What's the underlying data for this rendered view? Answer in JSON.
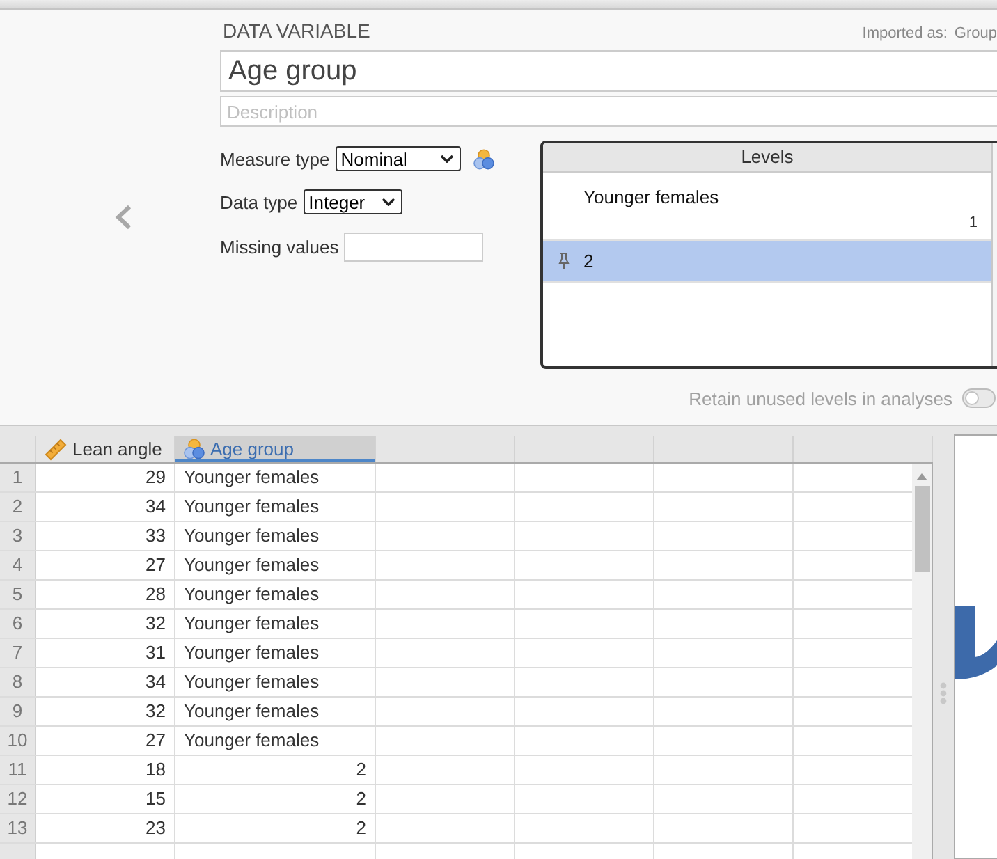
{
  "variable_editor": {
    "heading": "DATA VARIABLE",
    "imported_as": {
      "label": "Imported as:",
      "value": "Group"
    },
    "name": "Age group",
    "description": {
      "placeholder": "Description"
    },
    "measure_type": {
      "label": "Measure type",
      "value": "Nominal",
      "kind": "nominal"
    },
    "data_type": {
      "label": "Data type",
      "value": "Integer"
    },
    "missing_values": {
      "label": "Missing values"
    },
    "levels": {
      "title": "Levels",
      "items": [
        {
          "label": "Younger females",
          "value": "1",
          "selected": false
        },
        {
          "label": "2",
          "selected": true
        }
      ]
    },
    "retain_unused": {
      "label": "Retain unused levels in analyses",
      "on": false
    }
  },
  "spreadsheet": {
    "columns": [
      {
        "name": "Lean angle",
        "kind": "continuous",
        "selected": false
      },
      {
        "name": "Age group",
        "kind": "nominal",
        "selected": true
      }
    ],
    "rows": [
      {
        "index": "1",
        "cells": [
          {
            "value": "29",
            "kind": "number"
          },
          {
            "value": "Younger females",
            "kind": "label"
          }
        ]
      },
      {
        "index": "2",
        "cells": [
          {
            "value": "34",
            "kind": "number"
          },
          {
            "value": "Younger females",
            "kind": "label"
          }
        ]
      },
      {
        "index": "3",
        "cells": [
          {
            "value": "33",
            "kind": "number"
          },
          {
            "value": "Younger females",
            "kind": "label"
          }
        ]
      },
      {
        "index": "4",
        "cells": [
          {
            "value": "27",
            "kind": "number"
          },
          {
            "value": "Younger females",
            "kind": "label"
          }
        ]
      },
      {
        "index": "5",
        "cells": [
          {
            "value": "28",
            "kind": "number"
          },
          {
            "value": "Younger females",
            "kind": "label"
          }
        ]
      },
      {
        "index": "6",
        "cells": [
          {
            "value": "32",
            "kind": "number"
          },
          {
            "value": "Younger females",
            "kind": "label"
          }
        ]
      },
      {
        "index": "7",
        "cells": [
          {
            "value": "31",
            "kind": "number"
          },
          {
            "value": "Younger females",
            "kind": "label"
          }
        ]
      },
      {
        "index": "8",
        "cells": [
          {
            "value": "34",
            "kind": "number"
          },
          {
            "value": "Younger females",
            "kind": "label"
          }
        ]
      },
      {
        "index": "9",
        "cells": [
          {
            "value": "32",
            "kind": "number"
          },
          {
            "value": "Younger females",
            "kind": "label"
          }
        ]
      },
      {
        "index": "10",
        "cells": [
          {
            "value": "27",
            "kind": "number"
          },
          {
            "value": "Younger females",
            "kind": "label"
          }
        ]
      },
      {
        "index": "11",
        "cells": [
          {
            "value": "18",
            "kind": "number"
          },
          {
            "value": "2",
            "kind": "number"
          }
        ]
      },
      {
        "index": "12",
        "cells": [
          {
            "value": "15",
            "kind": "number"
          },
          {
            "value": "2",
            "kind": "number"
          }
        ]
      },
      {
        "index": "13",
        "cells": [
          {
            "value": "23",
            "kind": "number"
          },
          {
            "value": "2",
            "kind": "number"
          }
        ]
      }
    ]
  }
}
